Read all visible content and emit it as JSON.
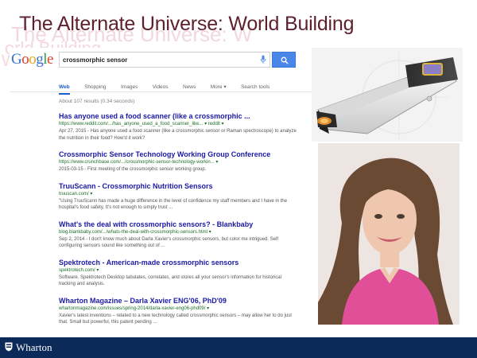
{
  "slide": {
    "title": "The Alternate Universe: World Building",
    "ghost_title_1": "The Alternate Universe: W",
    "ghost_title_2": "orld Building",
    "ghost_title_3": "World Building"
  },
  "search": {
    "logo": [
      "G",
      "o",
      "o",
      "g",
      "l",
      "e"
    ],
    "logo_colors": [
      "#3b6fd6",
      "#d6442c",
      "#e7a814",
      "#3b6fd6",
      "#2f9c4a",
      "#d6442c"
    ],
    "query": "crossmorphic sensor",
    "button_color": "#4a86e8",
    "tabs": [
      "Web",
      "Shopping",
      "Images",
      "Videos",
      "News",
      "More ▾",
      "Search tools"
    ],
    "stats": "About 107 results (0.34 seconds)",
    "results": [
      {
        "title": "Has anyone used a food scanner (like a crossmorphic ...",
        "url": "https://www.reddit.com/.../has_anyone_used_a_food_scanner_like... ▾  reddit ▾",
        "snippet": "Apr 27, 2015 - Has anyone used a food scanner (like a crossmorphic sensor or Raman spectroscope) to analyze the nutrition in their food? How'd it work?"
      },
      {
        "title": "Crossmorphic Sensor Technology Working Group Conference",
        "url": "https://www.crunchbase.com/.../crossmorphic-sensor-technology-workin... ▾",
        "snippet": "2015-03-15 - First meeting of the crossmorphic sensor working group."
      },
      {
        "title": "TruuScann - Crossmorphic Nutrition Sensors",
        "url": "truuscan.com/ ▾",
        "snippet": "\"Using TruuScann has made a huge difference in the level of confidence my staff members and I have in the hospital's food safety. It's not enough to simply trust ..."
      },
      {
        "title": "What's the deal with crossmorphic sensors? - Blankbaby",
        "url": "blog.blankbaby.com/.../whats-the-deal-with-crossmorphic-sensors.html ▾",
        "snippet": "Sep 2, 2014 - I don't know much about Darla Xavier's crossmorphic sensors, but color me intrigued. Self configuring sensors sound like something out of ..."
      },
      {
        "title": "Spektrotech - American-made crossmorphic sensors",
        "url": "spektrotech.com/ ▾",
        "snippet": "Software. Spektrotech Desktop tabulates, correlates, and stores all your sensor's information for historical tracking and analysis."
      },
      {
        "title": "Wharton Magazine – Darla Xavier ENG'06, PhD'09",
        "url": "whartonmagazine.com/issues/spring-2014/darla-xavier-eng06-phd09/ ▾",
        "snippet": "Xavier's latest inventions – related to a new technology called crossmorphic sensors – may allow her to do just that. Small but powerful, this patent pending ..."
      }
    ]
  },
  "footer": {
    "brand": "Wharton",
    "bar_color": "#0b2a5a"
  },
  "images": {
    "scanner_icon": "handheld-scanner-illustration",
    "portrait_icon": "woman-portrait-photo"
  }
}
